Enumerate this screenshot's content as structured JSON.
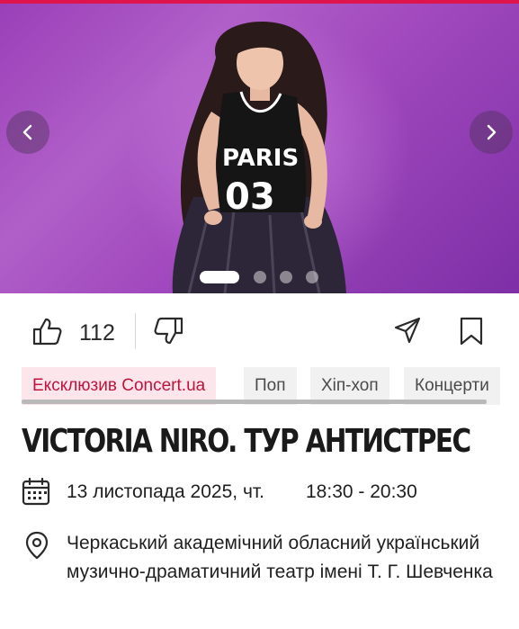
{
  "hero": {
    "slide_count": 4,
    "active_slide": 1,
    "shirt_text": "PARIS",
    "shirt_number": "03"
  },
  "actions": {
    "likes": "112"
  },
  "tags": [
    {
      "label": "Ексклюзив Concert.ua",
      "exclusive": true
    },
    {
      "label": "Поп",
      "exclusive": false
    },
    {
      "label": "Хіп-хоп",
      "exclusive": false
    },
    {
      "label": "Концерти",
      "exclusive": false
    }
  ],
  "event": {
    "title": "VICTORIA NIRO. ТУР АНТИСТРЕС",
    "date": "13 листопада 2025, чт.",
    "time": "18:30 - 20:30",
    "venue": "Черкаський академічний обласний український музично-драматичний театр імені Т. Г. Шевченка"
  },
  "colors": {
    "accent": "#e0144c",
    "exclusive_bg": "#fce6ec",
    "exclusive_text": "#c0143c",
    "hero_bg": "#a048bd"
  },
  "icons": {
    "prev": "chevron-left-icon",
    "next": "chevron-right-icon",
    "like": "thumbs-up-icon",
    "dislike": "thumbs-down-icon",
    "share": "send-icon",
    "bookmark": "bookmark-icon",
    "calendar": "calendar-icon",
    "location": "map-pin-icon"
  }
}
